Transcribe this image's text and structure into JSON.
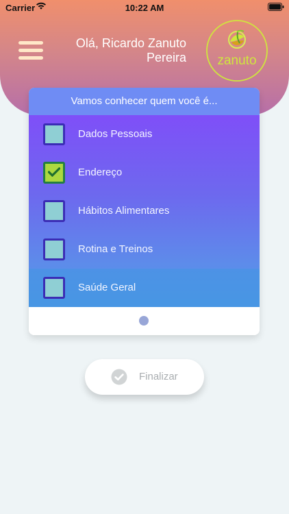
{
  "status_bar": {
    "carrier": "Carrier",
    "time": "10:22 AM",
    "wifi_icon": "wifi-icon",
    "battery_icon": "battery-icon"
  },
  "header": {
    "menu_icon": "hamburger-menu-icon",
    "greeting": "Olá, Ricardo Zanuto Pereira",
    "logo_text": "zanuto",
    "logo_icon": "zanuto-leaf-logo-icon",
    "colors": {
      "gradient_top": "#f08f6c",
      "gradient_bottom": "#b66fa9",
      "logo_accent": "#cfe73d"
    }
  },
  "questionnaire": {
    "title": "Vamos conhecer quem você é...",
    "items": [
      {
        "label": "Dados Pessoais",
        "checked": false
      },
      {
        "label": "Endereço",
        "checked": true
      },
      {
        "label": "Hábitos Alimentares",
        "checked": false
      },
      {
        "label": "Rotina e Treinos",
        "checked": false
      },
      {
        "label": "Saúde Geral",
        "checked": false
      }
    ],
    "pager": {
      "current_page": 1,
      "page_count": 1
    },
    "colors": {
      "title_bar": "#6f8cf4",
      "list_top": "#7f4ff8",
      "list_bottom": "#4f95e6",
      "checkbox_unchecked": "#8fcfd4",
      "checkbox_checked": "#acd83f"
    }
  },
  "actions": {
    "finalize_label": "Finalizar",
    "finalize_icon": "check-circle-icon"
  }
}
